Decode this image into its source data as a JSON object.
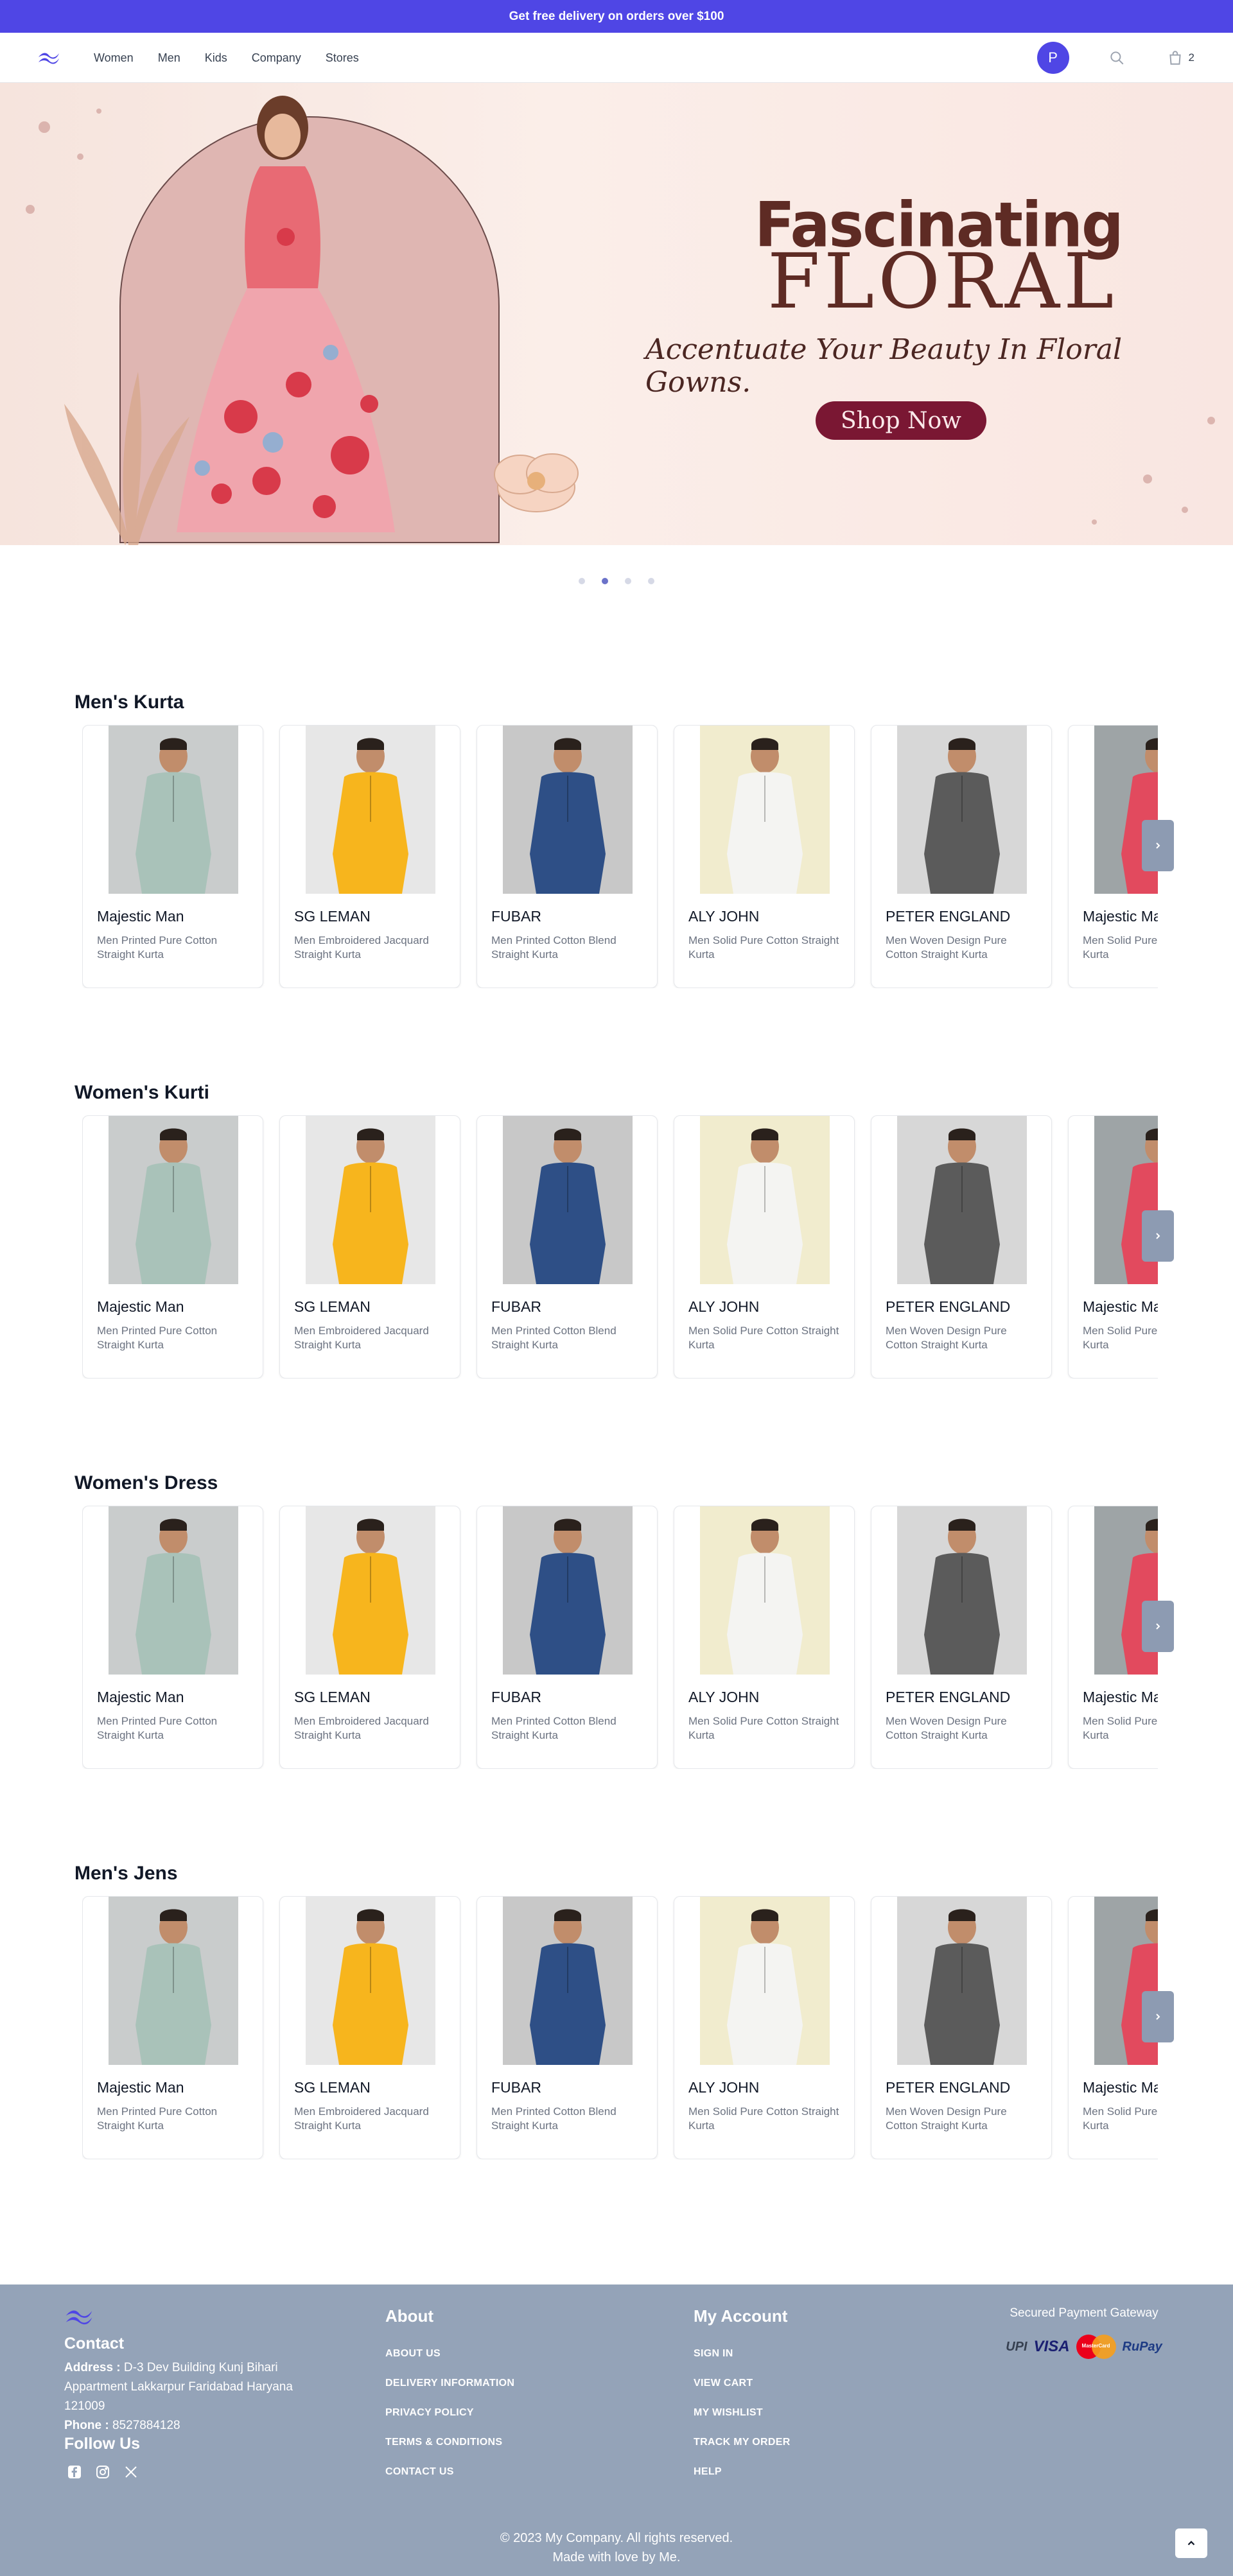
{
  "announcement": "Get free delivery on orders over $100",
  "nav": {
    "links": [
      "Women",
      "Men",
      "Kids",
      "Company",
      "Stores"
    ],
    "avatar_initial": "P",
    "cart_count": "2"
  },
  "hero": {
    "title_line1": "Fascinating",
    "title_line2": "FLORAL",
    "subtitle": "Accentuate Your Beauty In Floral Gowns.",
    "cta": "Shop Now",
    "slides": 4,
    "active_slide": 2
  },
  "products": [
    {
      "brand": "Majestic Man",
      "desc": "Men Printed Pure Cotton Straight Kurta",
      "shirt": "#a9c2b9",
      "bg": "bg1"
    },
    {
      "brand": "SG LEMAN",
      "desc": "Men Embroidered Jacquard Straight Kurta",
      "shirt": "#f7b51d",
      "bg": "bg2"
    },
    {
      "brand": "FUBAR",
      "desc": "Men Printed Cotton Blend Straight Kurta",
      "shirt": "#2e4f86",
      "bg": "bg3"
    },
    {
      "brand": "ALY JOHN",
      "desc": "Men Solid Pure Cotton Straight Kurta",
      "shirt": "#f4f4f2",
      "bg": "bg4"
    },
    {
      "brand": "PETER ENGLAND",
      "desc": "Men Woven Design Pure Cotton Straight Kurta",
      "shirt": "#5b5b5b",
      "bg": "bg5"
    },
    {
      "brand": "Majestic Man",
      "desc": "Men Solid Pure Cotton Straight Kurta",
      "shirt": "#e24a5e",
      "bg": "bg6"
    }
  ],
  "sections": [
    {
      "title": "Men's Kurta"
    },
    {
      "title": "Women's Kurti"
    },
    {
      "title": "Women's Dress"
    },
    {
      "title": "Men's Jens"
    }
  ],
  "footer": {
    "contact_title": "Contact",
    "address_label": "Address :",
    "address": "D-3 Dev Building Kunj Bihari Appartment Lakkarpur Faridabad Haryana 121009",
    "phone_label": "Phone :",
    "phone": "8527884128",
    "follow_title": "Follow Us",
    "about_title": "About",
    "about_links": [
      "ABOUT US",
      "DELIVERY INFORMATION",
      "PRIVACY POLICY",
      "TERMS & CONDITIONS",
      "CONTACT US"
    ],
    "account_title": "My Account",
    "account_links": [
      "SIGN IN",
      "VIEW CART",
      "MY WISHLIST",
      "TRACK MY ORDER",
      "HELP"
    ],
    "payment_title": "Secured Payment Gateway",
    "payment_methods": [
      "UPI",
      "VISA",
      "MasterCard",
      "RuPay"
    ],
    "copyright": "© 2023 My Company. All rights reserved.",
    "made_with": "Made with love by Me."
  }
}
